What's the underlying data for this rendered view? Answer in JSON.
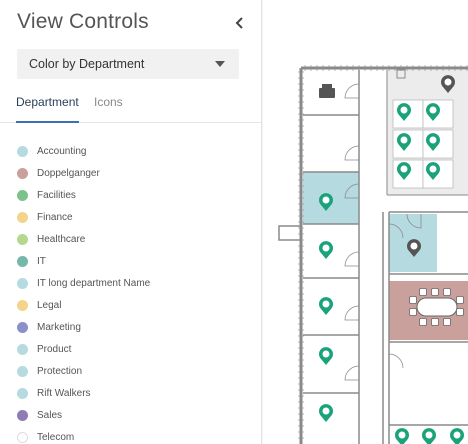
{
  "panel": {
    "title": "View Controls",
    "collapse_icon": "chevron-left-icon",
    "color_mode": {
      "selected": "Color by Department",
      "icon": "caret-down-icon"
    },
    "tabs": [
      {
        "label": "Department",
        "active": true
      },
      {
        "label": "Icons",
        "active": false
      }
    ],
    "legend": [
      {
        "label": "Accounting",
        "color": "#b5dbe0"
      },
      {
        "label": "Doppelganger",
        "color": "#c9a09c"
      },
      {
        "label": "Facilities",
        "color": "#7cc38b"
      },
      {
        "label": "Finance",
        "color": "#f4d38a"
      },
      {
        "label": "Healthcare",
        "color": "#b3d98f"
      },
      {
        "label": "IT",
        "color": "#76b7a9"
      },
      {
        "label": "IT long department Name",
        "color": "#b5dbe0"
      },
      {
        "label": "Legal",
        "color": "#f4d38a"
      },
      {
        "label": "Marketing",
        "color": "#8a90c9"
      },
      {
        "label": "Product",
        "color": "#b5dbe0"
      },
      {
        "label": "Protection",
        "color": "#b5dbe0"
      },
      {
        "label": "Rift Walkers",
        "color": "#b5dbe0"
      },
      {
        "label": "Sales",
        "color": "#8f7cb3"
      },
      {
        "label": "Telecom",
        "color": "#ffffff"
      }
    ]
  },
  "floorplan": {
    "colors": {
      "wall": "#8a8a8a",
      "room_teal": "#b5dbe0",
      "room_brown": "#c9a09c",
      "pin_green": "#1aa37a",
      "pin_dark": "#555555",
      "floor_grey": "#ececec"
    },
    "pins": {
      "green": 21,
      "dark": 2
    }
  }
}
